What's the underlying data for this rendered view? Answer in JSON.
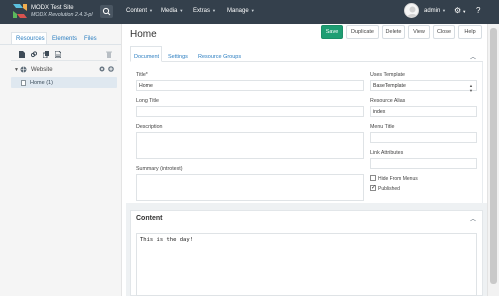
{
  "topbar": {
    "site_name": "MODX Test Site",
    "site_version": "MODX Revolution 2.4.3-pl",
    "nav": [
      {
        "label": "Content"
      },
      {
        "label": "Media"
      },
      {
        "label": "Extras"
      },
      {
        "label": "Manage"
      }
    ],
    "user": "admin",
    "icons": {
      "search": "search-icon",
      "settings": "gear-icon",
      "help": "question-icon"
    }
  },
  "left_panel": {
    "tabs": [
      "Resources",
      "Elements",
      "Files"
    ],
    "toolbar_icons": [
      "new-document-icon",
      "weblink-icon",
      "symlink-icon",
      "static-resource-icon",
      "trash-icon"
    ],
    "tree": {
      "root": "Website",
      "child": "Home (1)"
    }
  },
  "main": {
    "title": "Home",
    "buttons": {
      "save": "Save",
      "duplicate": "Duplicate",
      "delete": "Delete",
      "view": "View",
      "close": "Close",
      "help": "Help"
    },
    "tabs": [
      "Document",
      "Settings",
      "Resource Groups"
    ],
    "form": {
      "title_label": "Title*",
      "title_value": "Home",
      "long_title_label": "Long Title",
      "long_title_value": "",
      "description_label": "Description",
      "description_value": "",
      "summary_label": "Summary (introtext)",
      "summary_value": "",
      "template_label": "Uses Template",
      "template_value": "BaseTemplate",
      "alias_label": "Resource Alias",
      "alias_value": "index",
      "menu_title_label": "Menu Title",
      "menu_title_value": "",
      "link_attr_label": "Link Attributes",
      "link_attr_value": "",
      "hide_menus_label": "Hide From Menus",
      "hide_menus_checked": false,
      "published_label": "Published",
      "published_checked": true
    },
    "content": {
      "title": "Content",
      "body": "This is the day!"
    }
  },
  "colors": {
    "topbar": "#34404c",
    "accent": "#2b7ec1",
    "save": "#1e9e73"
  }
}
